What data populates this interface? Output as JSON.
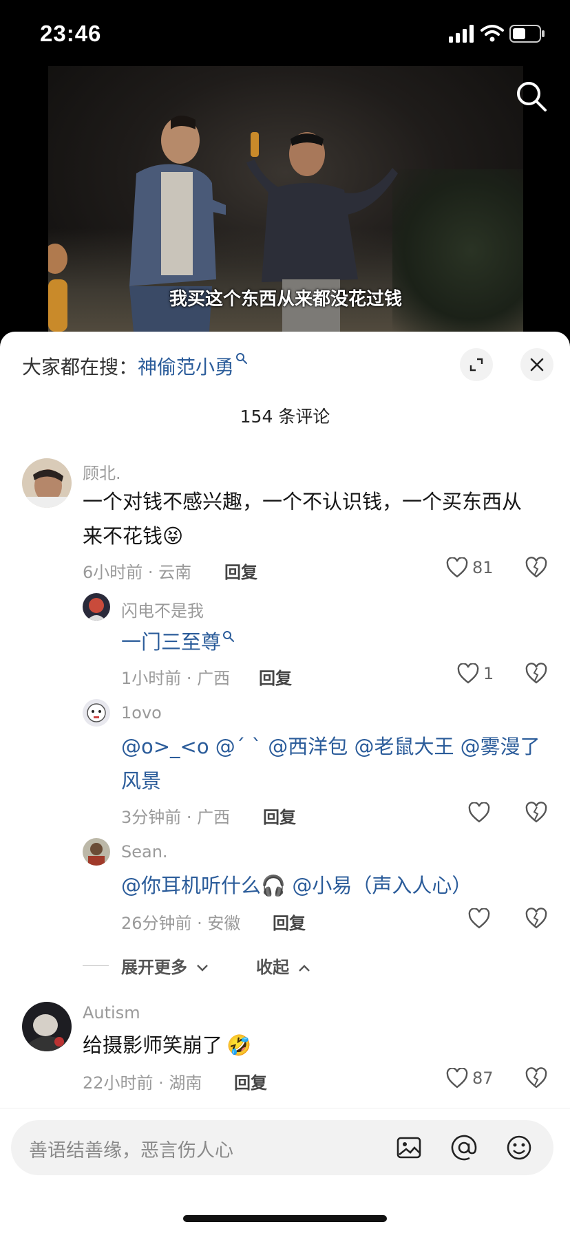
{
  "status_bar": {
    "time": "23:46"
  },
  "video": {
    "subtitle": "我买这个东西从来都没花过钱"
  },
  "hot_search": {
    "prefix": "大家都在搜：",
    "keyword": "神偷范小勇"
  },
  "comments_count": "154 条评论",
  "comments": [
    {
      "user": "顾北.",
      "text_line1": "一个对钱不感兴趣，一个不认识钱，一个买东西从",
      "text_line2": "来不花钱",
      "emoji": "😝",
      "meta": "6小时前 · 云南",
      "reply_label": "回复",
      "likes": "81"
    }
  ],
  "replies": [
    {
      "user": "闪电不是我",
      "text": "一门三至尊",
      "meta": "1小时前 · 广西",
      "reply_label": "回复",
      "likes": "1"
    },
    {
      "user": "1ovo",
      "text_line1": "@o>_<o @ˊ ˋ @西洋包 @老鼠大王 @雾漫了",
      "text_line2": "风景",
      "meta": "3分钟前 · 广西",
      "reply_label": "回复",
      "likes": ""
    },
    {
      "user": "Sean.",
      "text": "@你耳机听什么🎧 @小易（声入人心）",
      "meta": "26分钟前 · 安徽",
      "reply_label": "回复",
      "likes": ""
    }
  ],
  "thread_controls": {
    "expand_more": "展开更多",
    "collapse": "收起"
  },
  "comment2": {
    "user": "Autism",
    "text": "给摄影师笑崩了",
    "emoji": "🤣",
    "meta": "22小时前 · 湖南",
    "reply_label": "回复",
    "likes": "87"
  },
  "input_bar": {
    "placeholder": "善语结善缘，恶言伤人心"
  },
  "colors": {
    "link": "#2b5c9a",
    "muted": "#9a9a9a",
    "sheet_bg": "#ffffff"
  },
  "icons": [
    "search-icon",
    "expand-icon",
    "close-icon",
    "heart-icon",
    "dislike-heart-icon",
    "image-icon",
    "at-icon",
    "emoji-icon",
    "chevron-down-icon",
    "chevron-up-icon"
  ]
}
